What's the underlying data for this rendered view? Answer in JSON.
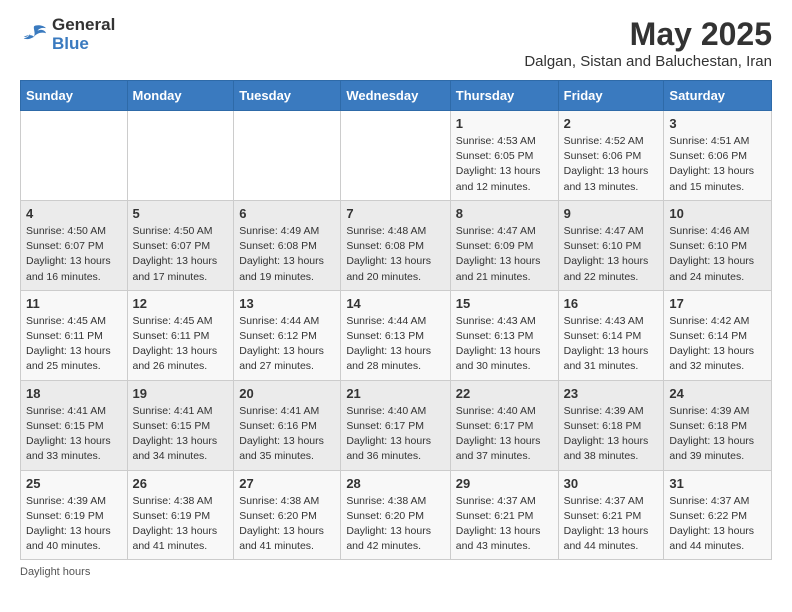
{
  "logo": {
    "line1": "General",
    "line2": "Blue"
  },
  "title": {
    "month_year": "May 2025",
    "location": "Dalgan, Sistan and Baluchestan, Iran"
  },
  "headers": [
    "Sunday",
    "Monday",
    "Tuesday",
    "Wednesday",
    "Thursday",
    "Friday",
    "Saturday"
  ],
  "weeks": [
    [
      {
        "day": "",
        "info": ""
      },
      {
        "day": "",
        "info": ""
      },
      {
        "day": "",
        "info": ""
      },
      {
        "day": "",
        "info": ""
      },
      {
        "day": "1",
        "info": "Sunrise: 4:53 AM\nSunset: 6:05 PM\nDaylight: 13 hours and 12 minutes."
      },
      {
        "day": "2",
        "info": "Sunrise: 4:52 AM\nSunset: 6:06 PM\nDaylight: 13 hours and 13 minutes."
      },
      {
        "day": "3",
        "info": "Sunrise: 4:51 AM\nSunset: 6:06 PM\nDaylight: 13 hours and 15 minutes."
      }
    ],
    [
      {
        "day": "4",
        "info": "Sunrise: 4:50 AM\nSunset: 6:07 PM\nDaylight: 13 hours and 16 minutes."
      },
      {
        "day": "5",
        "info": "Sunrise: 4:50 AM\nSunset: 6:07 PM\nDaylight: 13 hours and 17 minutes."
      },
      {
        "day": "6",
        "info": "Sunrise: 4:49 AM\nSunset: 6:08 PM\nDaylight: 13 hours and 19 minutes."
      },
      {
        "day": "7",
        "info": "Sunrise: 4:48 AM\nSunset: 6:08 PM\nDaylight: 13 hours and 20 minutes."
      },
      {
        "day": "8",
        "info": "Sunrise: 4:47 AM\nSunset: 6:09 PM\nDaylight: 13 hours and 21 minutes."
      },
      {
        "day": "9",
        "info": "Sunrise: 4:47 AM\nSunset: 6:10 PM\nDaylight: 13 hours and 22 minutes."
      },
      {
        "day": "10",
        "info": "Sunrise: 4:46 AM\nSunset: 6:10 PM\nDaylight: 13 hours and 24 minutes."
      }
    ],
    [
      {
        "day": "11",
        "info": "Sunrise: 4:45 AM\nSunset: 6:11 PM\nDaylight: 13 hours and 25 minutes."
      },
      {
        "day": "12",
        "info": "Sunrise: 4:45 AM\nSunset: 6:11 PM\nDaylight: 13 hours and 26 minutes."
      },
      {
        "day": "13",
        "info": "Sunrise: 4:44 AM\nSunset: 6:12 PM\nDaylight: 13 hours and 27 minutes."
      },
      {
        "day": "14",
        "info": "Sunrise: 4:44 AM\nSunset: 6:13 PM\nDaylight: 13 hours and 28 minutes."
      },
      {
        "day": "15",
        "info": "Sunrise: 4:43 AM\nSunset: 6:13 PM\nDaylight: 13 hours and 30 minutes."
      },
      {
        "day": "16",
        "info": "Sunrise: 4:43 AM\nSunset: 6:14 PM\nDaylight: 13 hours and 31 minutes."
      },
      {
        "day": "17",
        "info": "Sunrise: 4:42 AM\nSunset: 6:14 PM\nDaylight: 13 hours and 32 minutes."
      }
    ],
    [
      {
        "day": "18",
        "info": "Sunrise: 4:41 AM\nSunset: 6:15 PM\nDaylight: 13 hours and 33 minutes."
      },
      {
        "day": "19",
        "info": "Sunrise: 4:41 AM\nSunset: 6:15 PM\nDaylight: 13 hours and 34 minutes."
      },
      {
        "day": "20",
        "info": "Sunrise: 4:41 AM\nSunset: 6:16 PM\nDaylight: 13 hours and 35 minutes."
      },
      {
        "day": "21",
        "info": "Sunrise: 4:40 AM\nSunset: 6:17 PM\nDaylight: 13 hours and 36 minutes."
      },
      {
        "day": "22",
        "info": "Sunrise: 4:40 AM\nSunset: 6:17 PM\nDaylight: 13 hours and 37 minutes."
      },
      {
        "day": "23",
        "info": "Sunrise: 4:39 AM\nSunset: 6:18 PM\nDaylight: 13 hours and 38 minutes."
      },
      {
        "day": "24",
        "info": "Sunrise: 4:39 AM\nSunset: 6:18 PM\nDaylight: 13 hours and 39 minutes."
      }
    ],
    [
      {
        "day": "25",
        "info": "Sunrise: 4:39 AM\nSunset: 6:19 PM\nDaylight: 13 hours and 40 minutes."
      },
      {
        "day": "26",
        "info": "Sunrise: 4:38 AM\nSunset: 6:19 PM\nDaylight: 13 hours and 41 minutes."
      },
      {
        "day": "27",
        "info": "Sunrise: 4:38 AM\nSunset: 6:20 PM\nDaylight: 13 hours and 41 minutes."
      },
      {
        "day": "28",
        "info": "Sunrise: 4:38 AM\nSunset: 6:20 PM\nDaylight: 13 hours and 42 minutes."
      },
      {
        "day": "29",
        "info": "Sunrise: 4:37 AM\nSunset: 6:21 PM\nDaylight: 13 hours and 43 minutes."
      },
      {
        "day": "30",
        "info": "Sunrise: 4:37 AM\nSunset: 6:21 PM\nDaylight: 13 hours and 44 minutes."
      },
      {
        "day": "31",
        "info": "Sunrise: 4:37 AM\nSunset: 6:22 PM\nDaylight: 13 hours and 44 minutes."
      }
    ]
  ],
  "footer": {
    "note": "Daylight hours"
  }
}
